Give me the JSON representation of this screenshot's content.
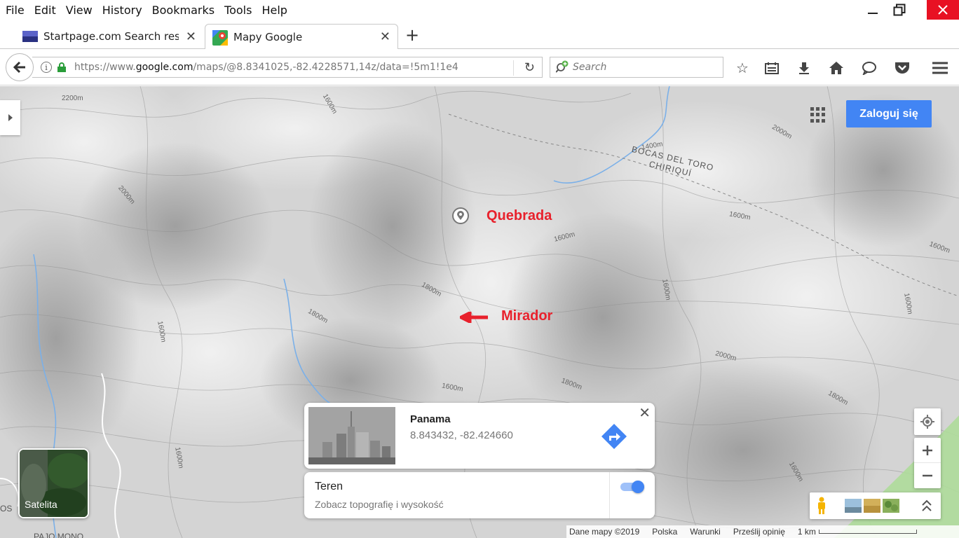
{
  "menubar": {
    "items": [
      "File",
      "Edit",
      "View",
      "History",
      "Bookmarks",
      "Tools",
      "Help"
    ]
  },
  "window": {
    "minimize_icon": "minimize-icon",
    "restore_icon": "restore-icon",
    "close_icon": "close-icon"
  },
  "tabs": [
    {
      "title": "Startpage.com Search res...",
      "favicon": "startpage-favicon",
      "active": false
    },
    {
      "title": "Mapy Google",
      "favicon": "google-maps-favicon",
      "active": true
    }
  ],
  "navbar": {
    "url_prefix": "https://www.",
    "url_host": "google.com",
    "url_path": "/maps/@8.8341025,-82.4228571,14z/data=!5m1!1e4",
    "search_placeholder": "Search"
  },
  "map": {
    "signin_label": "Zaloguj się",
    "annotations": [
      "Quebrada",
      "Mirador"
    ],
    "annotation_color": "#e8212c",
    "region_label": [
      "BOCAS DEL TORO",
      "CHIRIQUÍ"
    ],
    "contour_labels": [
      "2200m",
      "1600m",
      "2000m",
      "1400m",
      "1600m",
      "1600m",
      "1600m",
      "1800m",
      "1800m",
      "1600m",
      "1600m",
      "2000m",
      "1800m",
      "1600m",
      "1600m",
      "1600m",
      "1600m",
      "2000m",
      "1800m"
    ],
    "bottom_left_label": "OS",
    "bottom_label": "PAJO MONO"
  },
  "info_card": {
    "place_name": "Panama",
    "coordinates": "8.843432, -82.424660"
  },
  "terrain_card": {
    "title": "Teren",
    "subtitle": "Zobacz topografię i wysokość",
    "enabled": true
  },
  "satellite": {
    "label": "Satelita"
  },
  "footer": {
    "map_data": "Dane mapy ©2019",
    "country": "Polska",
    "terms": "Warunki",
    "feedback": "Prześlij opinię",
    "scale": "1 km"
  },
  "colors": {
    "accent": "#4285f4",
    "window_close": "#e81123",
    "map_bg": "#d6d6d6"
  }
}
